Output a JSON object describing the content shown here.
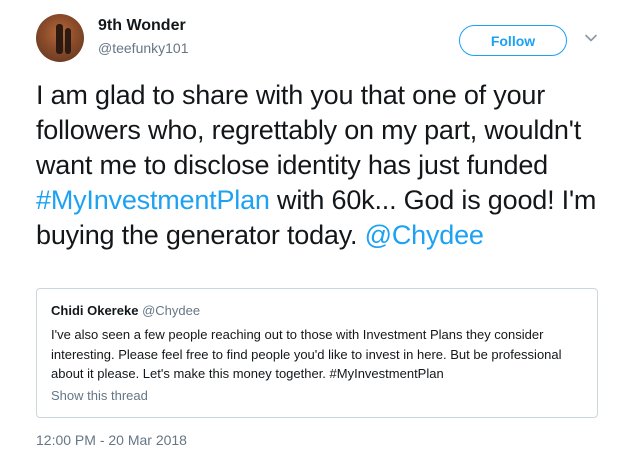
{
  "author": {
    "name": "9th Wonder",
    "handle": "@teefunky101"
  },
  "follow_label": "Follow",
  "tweet": {
    "text_1": "I am glad to share with you that one of your followers who, regrettably on my part, wouldn't want me to disclose identity has just funded ",
    "hashtag": "#MyInvestmentPlan",
    "text_2": " with 60k... God is good! I'm buying the generator today. ",
    "mention": "@Chydee"
  },
  "quoted": {
    "name": "Chidi Okereke",
    "handle": "@Chydee",
    "text": "I've also seen a few people reaching out to those with Investment Plans they consider interesting. Please feel free to find people you'd like to invest in here. But be professional about it please. Let's make this money together. #MyInvestmentPlan",
    "show_thread": "Show this thread"
  },
  "timestamp": "12:00 PM - 20 Mar 2018",
  "colors": {
    "accent": "#1da1f2",
    "secondary_text": "#657786",
    "border": "#ccd6dd"
  },
  "icons": [
    "avatar-photo",
    "chevron-down-icon"
  ]
}
